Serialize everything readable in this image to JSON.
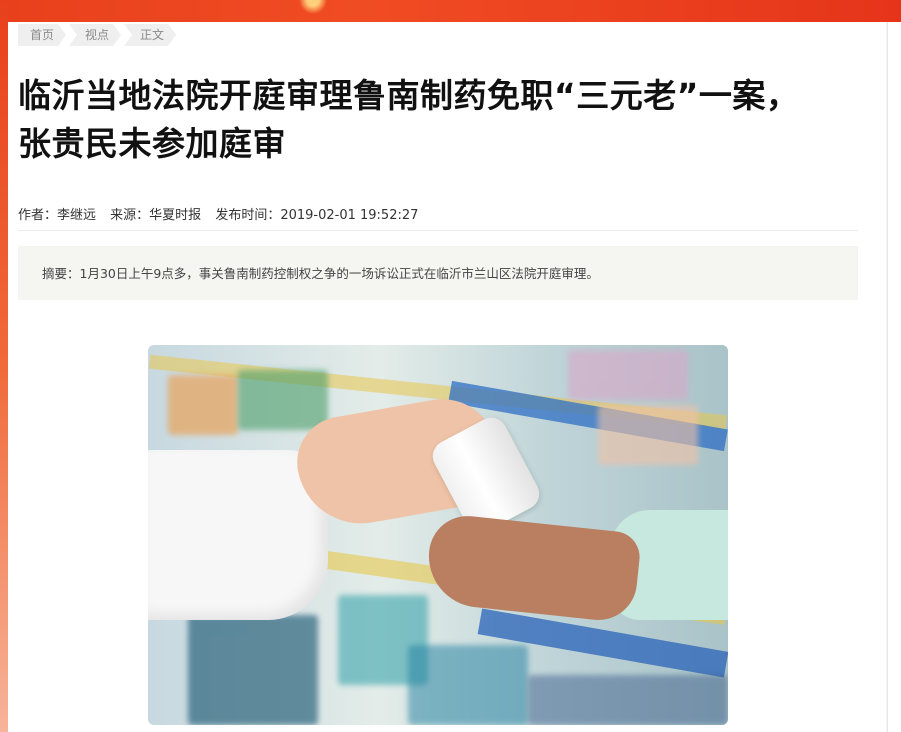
{
  "breadcrumb": [
    "首页",
    "视点",
    "正文"
  ],
  "article": {
    "title": "临沂当地法院开庭审理鲁南制药免职“三元老”一案，张贵民未参加庭审",
    "author": "作者：李继远",
    "source": "来源：华夏时报",
    "publish_time": "发布时间：2019-02-01 19:52:27",
    "summary": "摘要：1月30日上午9点多，事关鲁南制药控制权之争的一场诉讼正式在临沂市兰山区法院开庭审理。"
  },
  "colors": {
    "brand_red": "#e8401c",
    "summary_bg": "#f5f5f2",
    "crumb_bg": "#efefef"
  }
}
